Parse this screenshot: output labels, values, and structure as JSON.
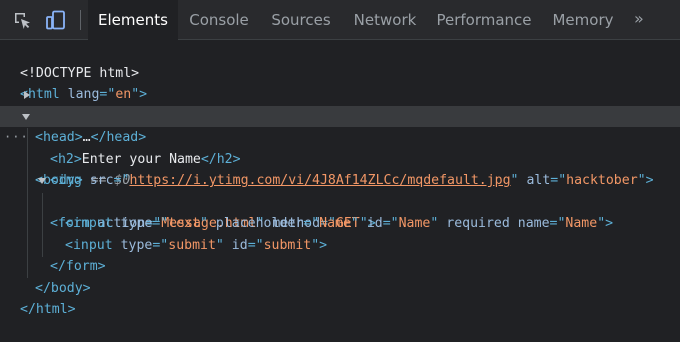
{
  "toolbar": {
    "icons": [
      "inspect-element-icon",
      "device-toolbar-icon"
    ],
    "tabs": [
      {
        "label": "Elements",
        "active": true
      },
      {
        "label": "Console",
        "active": false
      },
      {
        "label": "Sources",
        "active": false
      },
      {
        "label": "Network",
        "active": false
      },
      {
        "label": "Performance",
        "active": false
      },
      {
        "label": "Memory",
        "active": false
      }
    ],
    "more": "»"
  },
  "dom": {
    "doctype": "<!DOCTYPE html>",
    "html_open": {
      "tag": "<html",
      "attr": "lang",
      "eq": "=\"",
      "value": "en",
      "close": "\">"
    },
    "head": {
      "open": "<head>",
      "ellipsis": "…",
      "close": "</head>"
    },
    "body": {
      "open": "<body>",
      "marker": "== $0",
      "dots": "···"
    },
    "h2": {
      "open": "<h2>",
      "text": "Enter your Name",
      "close": "</h2>"
    },
    "img": {
      "tag": "<img",
      "src_attr": "src",
      "src_value": "https://i.ytimg.com/vi/4J8Af14ZLCc/mqdefault.jpg",
      "alt_attr": "alt",
      "alt_value": "hacktober",
      "close": ">"
    },
    "form": {
      "tag": "<form",
      "action_attr": "action",
      "action_value": "Message.html",
      "method_attr": "method",
      "method_value": "GET",
      "close": ">"
    },
    "input1": {
      "tag": "<input",
      "type_attr": "type",
      "type_value": "text",
      "placeholder_attr": "placeholder",
      "placeholder_value": "Name",
      "id_attr": "id",
      "id_value": "Name",
      "required_attr": "required",
      "name_attr": "name",
      "name_value": "Name",
      "close": ">"
    },
    "input2": {
      "tag": "<input",
      "type_attr": "type",
      "type_value": "submit",
      "id_attr": "id",
      "id_value": "submit",
      "close": ">"
    },
    "form_close": "</form>",
    "body_close": "</body>",
    "html_close": "</html>"
  }
}
